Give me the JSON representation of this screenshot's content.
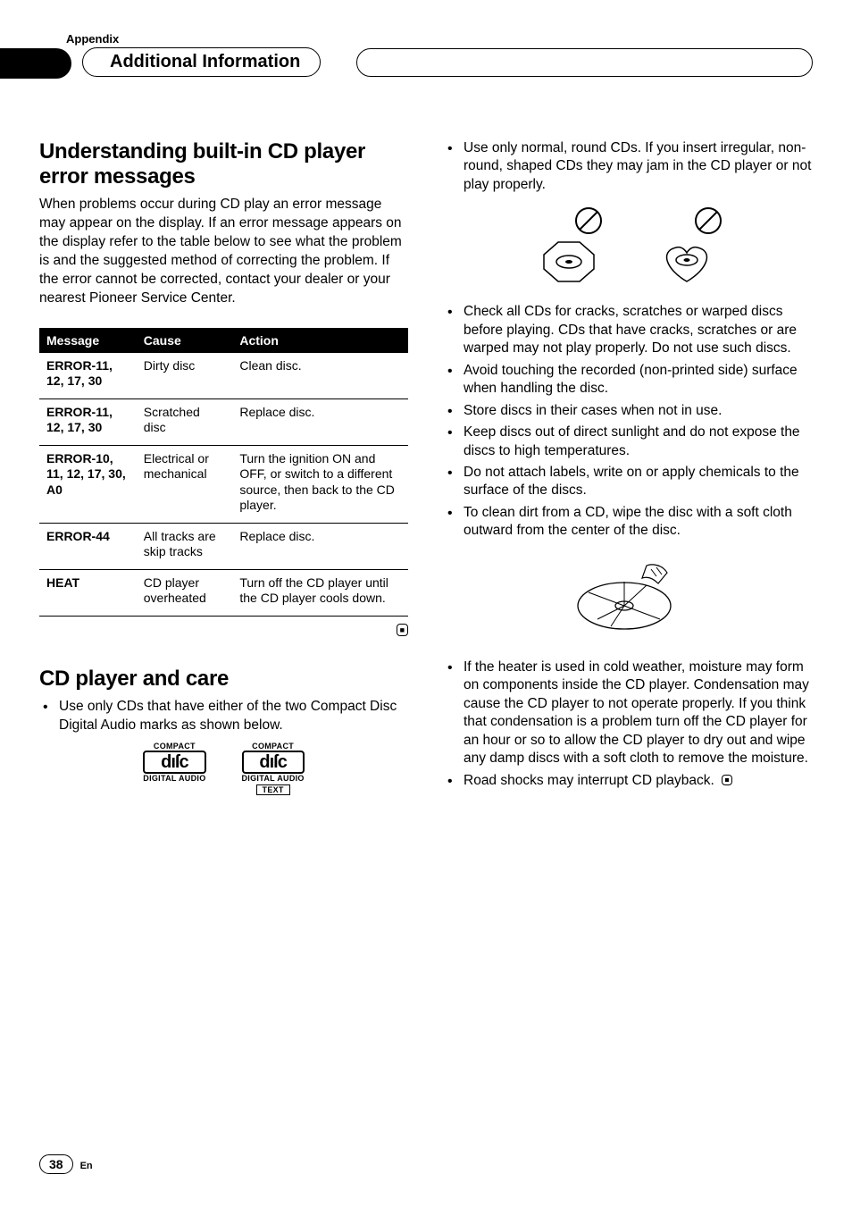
{
  "header": {
    "appendix": "Appendix",
    "pill_title": "Additional Information"
  },
  "section1": {
    "title": "Understanding built-in CD player error messages",
    "intro": "When problems occur during CD play an error message may appear on the display. If an error message appears on the display refer to the table below to see what the problem is and the suggested method of correcting the problem. If the error cannot be corrected, contact your dealer or your nearest Pioneer Service Center."
  },
  "err_table": {
    "headers": {
      "message": "Message",
      "cause": "Cause",
      "action": "Action"
    },
    "rows": [
      {
        "message": "ERROR-11, 12, 17, 30",
        "cause": "Dirty disc",
        "action": "Clean disc."
      },
      {
        "message": "ERROR-11, 12, 17, 30",
        "cause": "Scratched disc",
        "action": "Replace disc."
      },
      {
        "message": "ERROR-10, 11, 12, 17, 30, A0",
        "cause": "Electrical or mechanical",
        "action": "Turn the ignition ON and OFF, or switch to a different source, then back to the CD player."
      },
      {
        "message": "ERROR-44",
        "cause": "All tracks are skip tracks",
        "action": "Replace disc."
      },
      {
        "message": "HEAT",
        "cause": "CD player overheated",
        "action": "Turn off the CD player until the CD player cools down."
      }
    ]
  },
  "section2": {
    "title": "CD player and care",
    "bullets_left": [
      "Use only CDs that have either of the two Compact Disc Digital Audio marks as shown below."
    ]
  },
  "logos": {
    "top": "COMPACT",
    "mid": "dıſc",
    "bottom": "DIGITAL AUDIO",
    "text": "TEXT"
  },
  "bullets_right_a": [
    "Use only normal, round CDs. If you insert irregular, non-round, shaped CDs they may jam in the CD player or not play properly."
  ],
  "bullets_right_b": [
    "Check all CDs for cracks, scratches or warped discs before playing. CDs that have cracks, scratches or are warped may not play properly. Do not use such discs.",
    "Avoid touching the recorded (non-printed side) surface when handling the disc.",
    "Store discs in their cases when not in use.",
    "Keep discs out of direct sunlight and do not expose the discs to high temperatures.",
    "Do not attach labels, write on or apply chemicals to the surface of the discs.",
    "To clean dirt from a CD, wipe the disc with a soft cloth outward from the center of the disc."
  ],
  "bullets_right_c": [
    "If the heater is used in cold weather, moisture may form on components inside the CD player. Condensation may cause the CD player to not operate properly. If you think that condensation is a problem turn off the CD player for an hour or so to allow the CD player to dry out and wipe any damp discs with a soft cloth to remove the moisture.",
    "Road shocks may interrupt CD playback."
  ],
  "footer": {
    "page": "38",
    "lang": "En"
  }
}
